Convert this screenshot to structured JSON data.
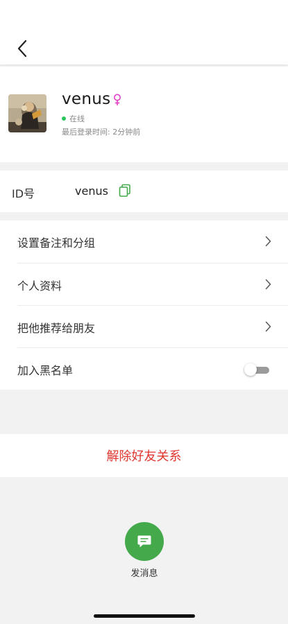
{
  "nav": {
    "back_icon": "chevron-left-icon"
  },
  "profile": {
    "name": "venus",
    "gender_icon": "female-icon",
    "status": "在线",
    "last_login": "最后登录时间: 2分钟前",
    "avatar_icon": "avatar-photo"
  },
  "id_section": {
    "label": "ID号",
    "value": "venus",
    "copy_icon": "copy-icon"
  },
  "menu": {
    "items": [
      {
        "label": "设置备注和分组",
        "icon": "chevron-right-icon"
      },
      {
        "label": "个人资料",
        "icon": "chevron-right-icon"
      },
      {
        "label": "把他推荐给朋友",
        "icon": "chevron-right-icon"
      },
      {
        "label": "加入黑名单",
        "toggle_on": false
      }
    ]
  },
  "actions": {
    "unfriend_label": "解除好友关系",
    "send_message_label": "发消息",
    "send_message_icon": "chat-bubble-icon"
  },
  "colors": {
    "accent_green": "#43a94a",
    "online_dot": "#2ec45c",
    "danger_red": "#e0362f",
    "gender_pink": "#e040c8"
  }
}
